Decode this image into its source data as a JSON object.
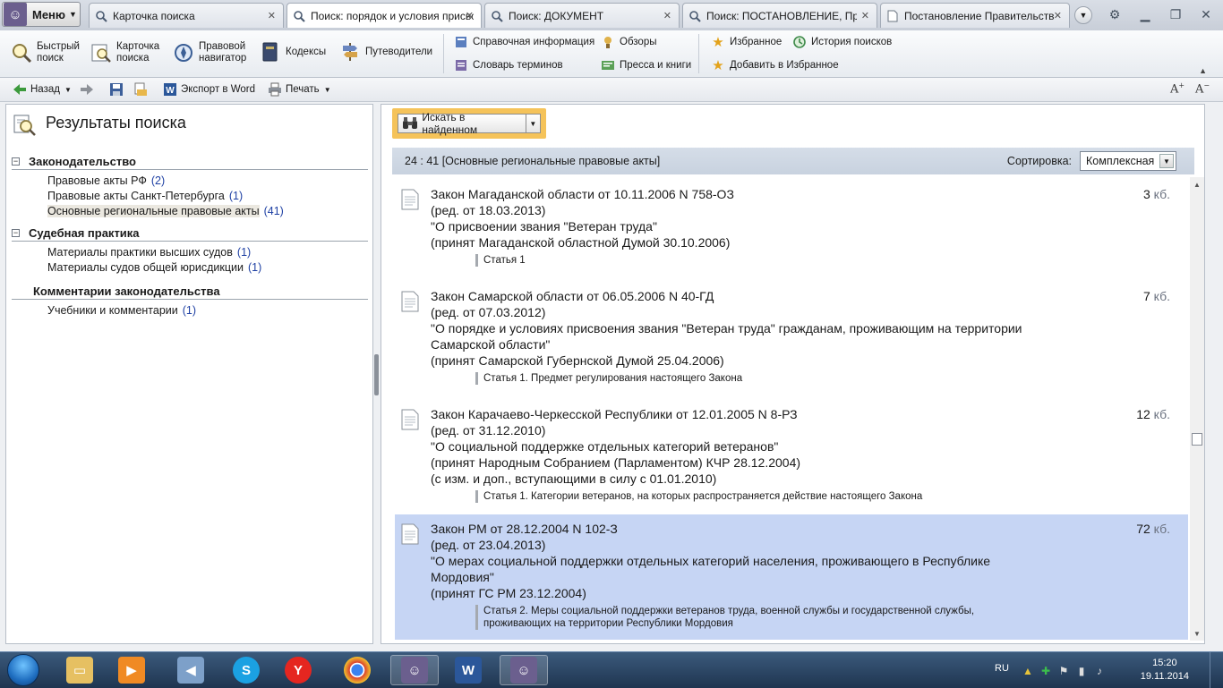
{
  "tabs": {
    "menu_label": "Меню",
    "items": [
      {
        "label": "Карточка поиска",
        "active": false
      },
      {
        "label": "Поиск: порядок и условия присвоения звания",
        "active": true
      },
      {
        "label": "Поиск: ДОКУМЕНТ",
        "active": false
      },
      {
        "label": "Поиск: ПОСТАНОВЛЕНИЕ, Правительство",
        "active": false
      },
      {
        "label": "Постановление Правительства Российской Федерации",
        "active": false
      }
    ]
  },
  "ribbon": {
    "quick_search": "Быстрый поиск",
    "quick_search_l1": "Быстрый",
    "quick_search_l2": "поиск",
    "search_card_l1": "Карточка",
    "search_card_l2": "поиска",
    "legal_nav_l1": "Правовой",
    "legal_nav_l2": "навигатор",
    "codes": "Кодексы",
    "guides": "Путеводители",
    "reference_info": "Справочная информация",
    "glossary": "Словарь терминов",
    "reviews": "Обзоры",
    "press_books": "Пресса и книги",
    "favorites": "Избранное",
    "add_favorites": "Добавить в Избранное",
    "search_history": "История поисков"
  },
  "toolbar": {
    "back": "Назад",
    "export_word": "Экспорт в Word",
    "print": "Печать"
  },
  "left_panel": {
    "title": "Результаты поиска",
    "groups": [
      {
        "title": "Законодательство",
        "expanded": true,
        "items": [
          {
            "label": "Правовые акты РФ",
            "count": "(2)",
            "selected": false
          },
          {
            "label": "Правовые акты Санкт-Петербурга",
            "count": "(1)",
            "selected": false
          },
          {
            "label": "Основные региональные правовые акты",
            "count": "(41)",
            "selected": true
          }
        ]
      },
      {
        "title": "Судебная практика",
        "expanded": true,
        "items": [
          {
            "label": "Материалы практики высших судов",
            "count": "(1)",
            "selected": false
          },
          {
            "label": "Материалы судов общей юрисдикции",
            "count": "(1)",
            "selected": false
          }
        ]
      },
      {
        "title": "Комментарии законодательства",
        "expanded": true,
        "items": [
          {
            "label": "Учебники и комментарии",
            "count": "(1)",
            "selected": false
          }
        ]
      }
    ]
  },
  "right_panel": {
    "search_in_found": "Искать в найденном",
    "header_text": "24 : 41 [Основные региональные правовые акты]",
    "sort_label": "Сортировка:",
    "sort_value": "Комплексная",
    "size_unit": "кб.",
    "results": [
      {
        "lines": [
          "Закон Магаданской области от 10.11.2006 N 758-ОЗ",
          "(ред. от 18.03.2013)",
          "\"О присвоении звания \"Ветеран труда\"",
          "(принят Магаданской областной Думой 30.10.2006)"
        ],
        "size": "3",
        "article": [
          "Статья 1"
        ],
        "selected": false
      },
      {
        "lines": [
          "Закон Самарской области от 06.05.2006 N 40-ГД",
          "(ред. от 07.03.2012)",
          "\"О порядке и условиях присвоения звания \"Ветеран труда\" гражданам, проживающим на территории",
          "Самарской области\"",
          "(принят Самарской Губернской Думой 25.04.2006)"
        ],
        "size": "7",
        "article": [
          "Статья 1. Предмет регулирования настоящего Закона"
        ],
        "selected": false
      },
      {
        "lines": [
          "Закон Карачаево-Черкесской Республики от 12.01.2005 N 8-РЗ",
          "(ред. от 31.12.2010)",
          "\"О социальной поддержке отдельных категорий ветеранов\"",
          "(принят Народным Собранием (Парламентом) КЧР 28.12.2004)",
          "(с изм. и доп., вступающими в силу с 01.01.2010)"
        ],
        "size": "12",
        "article": [
          "Статья 1. Категории ветеранов, на которых распространяется действие настоящего Закона"
        ],
        "selected": false
      },
      {
        "lines": [
          "Закон РМ от 28.12.2004 N 102-З",
          "(ред. от 23.04.2013)",
          "\"О мерах социальной поддержки отдельных категорий населения, проживающего в Республике",
          "Мордовия\"",
          "(принят ГС РМ 23.12.2004)"
        ],
        "size": "72",
        "article": [
          "Статья 2. Меры социальной поддержки ветеранов труда, военной службы и государственной службы,",
          "проживающих на территории Республики Мордовия"
        ],
        "selected": true
      }
    ]
  },
  "taskbar": {
    "lang": "RU",
    "time": "15:20",
    "date": "19.11.2014"
  },
  "colors": {
    "accent_orange": "#f5c35a",
    "selected_row": "#c6d5f4",
    "count_blue": "#1d3fa3"
  }
}
